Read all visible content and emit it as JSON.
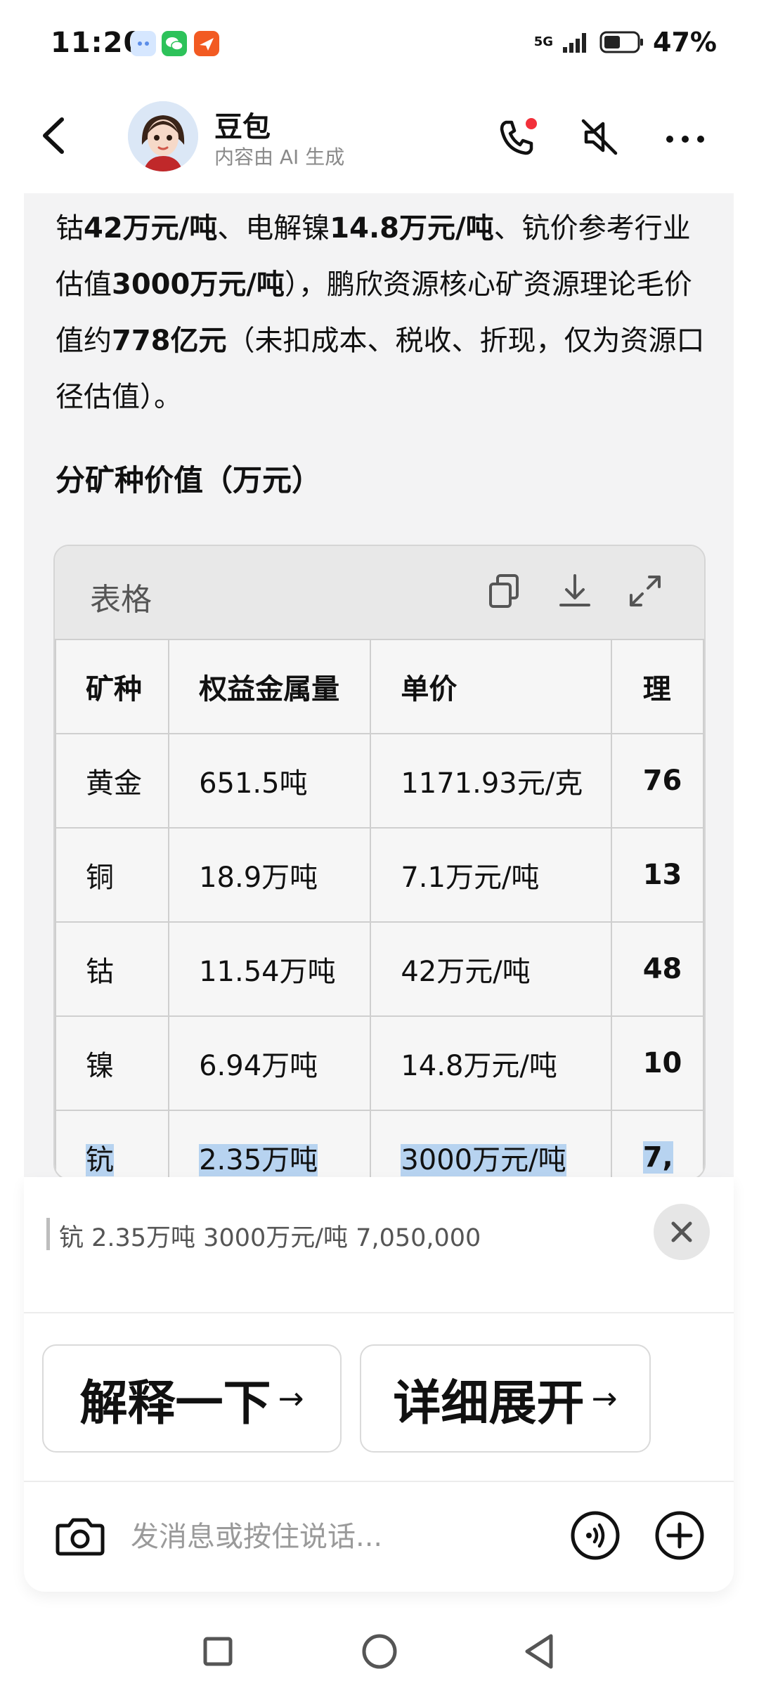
{
  "status_bar": {
    "time": "11:20",
    "network": "5G",
    "battery": "47%"
  },
  "header": {
    "title": "豆包",
    "subtitle": "内容由 AI 生成"
  },
  "message": {
    "paragraph_html": "钴<b>42万元/吨</b>、电解镍<b>14.8万元/吨</b>、钪价参考行业估值<b>3000万元/吨</b>），鹏欣资源核心矿资源理论毛价值约<b>778亿元</b>（未扣成本、税收、折现，仅为资源口径估值）。",
    "section_heading": "分矿种价值（万元）"
  },
  "table": {
    "label": "表格",
    "columns": [
      "矿种",
      "权益金属量",
      "单价",
      "理"
    ],
    "rows": [
      [
        "黄金",
        "651.5吨",
        "1171.93元/克",
        "76"
      ],
      [
        "铜",
        "18.9万吨",
        "7.1万元/吨",
        "13"
      ],
      [
        "钴",
        "11.54万吨",
        "42万元/吨",
        "48"
      ],
      [
        "镍",
        "6.94万吨",
        "14.8万元/吨",
        "10"
      ],
      [
        "钪",
        "2.35万吨",
        "3000万元/吨",
        "7,"
      ]
    ]
  },
  "selection": {
    "quote": "钪 2.35万吨 3000万元/吨 7,050,000"
  },
  "suggestions": {
    "explain": "解释一下",
    "expand": "详细展开",
    "arrow": "→"
  },
  "composer": {
    "placeholder": "发消息或按住说话..."
  }
}
